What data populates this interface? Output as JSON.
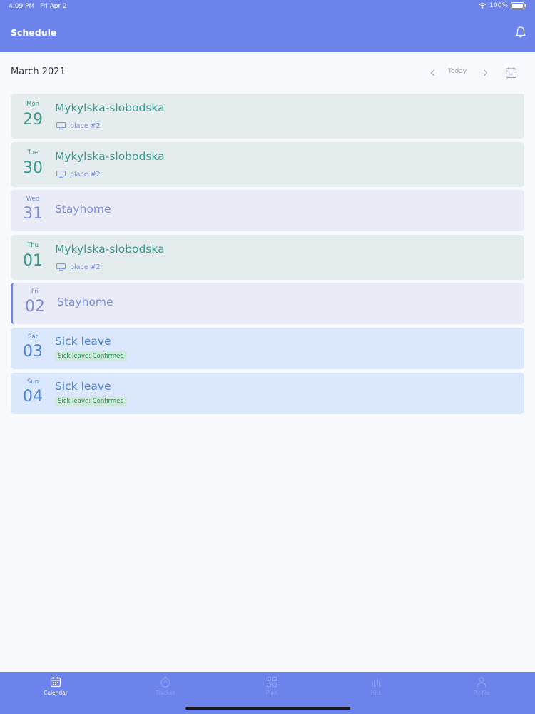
{
  "status_bar": {
    "time": "4:09 PM",
    "date": "Fri Apr 2",
    "battery": "100%"
  },
  "header": {
    "title": "Schedule",
    "bell_icon": "bell-icon"
  },
  "calendar_nav": {
    "month": "March 2021",
    "today_label": "Today",
    "prev_icon": "chevron-left-icon",
    "next_icon": "chevron-right-icon",
    "add_icon": "calendar-add-icon"
  },
  "days": [
    {
      "dow": "Mon",
      "day": "29",
      "title": "Mykylska-slobodska",
      "place": "place #2",
      "kind": "office"
    },
    {
      "dow": "Tue",
      "day": "30",
      "title": "Mykylska-slobodska",
      "place": "place #2",
      "kind": "office"
    },
    {
      "dow": "Wed",
      "day": "31",
      "title": "Stayhome",
      "kind": "home"
    },
    {
      "dow": "Thu",
      "day": "01",
      "title": "Mykylska-slobodska",
      "place": "place #2",
      "kind": "office"
    },
    {
      "dow": "Fri",
      "day": "02",
      "title": "Stayhome",
      "kind": "home",
      "active": true
    },
    {
      "dow": "Sat",
      "day": "03",
      "title": "Sick leave",
      "status": "Sick leave: Confirmed",
      "kind": "sick"
    },
    {
      "dow": "Sun",
      "day": "04",
      "title": "Sick leave",
      "status": "Sick leave: Confirmed",
      "kind": "sick"
    }
  ],
  "tabbar": {
    "items": [
      {
        "label": "Calendar",
        "icon": "calendar-icon",
        "active": true
      },
      {
        "label": "Tracker",
        "icon": "timer-icon",
        "active": false
      },
      {
        "label": "Plan",
        "icon": "grid-icon",
        "active": false
      },
      {
        "label": "Hits",
        "icon": "bar-chart-icon",
        "active": false
      },
      {
        "label": "Profile",
        "icon": "person-icon",
        "active": false
      }
    ]
  },
  "colors": {
    "accent": "#6c83ec",
    "office_bg": "#e4eced",
    "home_bg": "#e9ebf7",
    "sick_bg": "#dbe7fc",
    "confirmed_badge": "#cfe8dc"
  }
}
